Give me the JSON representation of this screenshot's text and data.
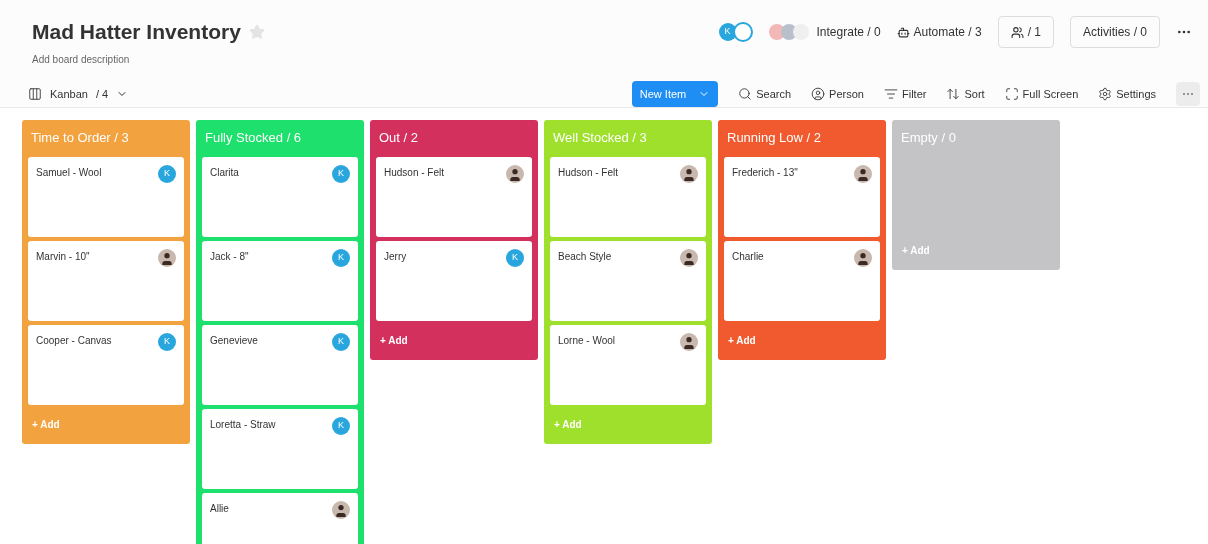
{
  "board": {
    "title": "Mad Hatter Inventory",
    "description": "Add board description",
    "view": {
      "label": "Kanban",
      "count": "/ 4"
    }
  },
  "top_bar": {
    "avatar_initial": "K",
    "integrate": "Integrate / 0",
    "automate": "Automate / 3",
    "members": "/ 1",
    "activities": "Activities / 0"
  },
  "toolbar": {
    "new_item": "New Item",
    "search": "Search",
    "person": "Person",
    "filter": "Filter",
    "sort": "Sort",
    "full_screen": "Full Screen",
    "settings": "Settings"
  },
  "columns": [
    {
      "title": "Time to Order / 3",
      "color": "#f2a23e",
      "add": "+ Add",
      "cards": [
        {
          "name": "Samuel - Wool",
          "assignee": {
            "kind": "initial",
            "text": "K"
          }
        },
        {
          "name": "Marvin - 10\"",
          "assignee": {
            "kind": "photo"
          }
        },
        {
          "name": "Cooper - Canvas",
          "assignee": {
            "kind": "initial",
            "text": "K"
          }
        }
      ]
    },
    {
      "title": "Fully Stocked / 6",
      "color": "#1ee06c",
      "cards": [
        {
          "name": "Clarita",
          "assignee": {
            "kind": "initial",
            "text": "K"
          }
        },
        {
          "name": "Jack - 8\"",
          "assignee": {
            "kind": "initial",
            "text": "K"
          }
        },
        {
          "name": "Genevieve",
          "assignee": {
            "kind": "initial",
            "text": "K"
          }
        },
        {
          "name": "Loretta - Straw",
          "assignee": {
            "kind": "initial",
            "text": "K"
          }
        },
        {
          "name": "Allie",
          "assignee": {
            "kind": "photo"
          }
        }
      ]
    },
    {
      "title": "Out / 2",
      "color": "#d3305e",
      "add": "+ Add",
      "cards": [
        {
          "name": "Hudson - Felt",
          "assignee": {
            "kind": "photo"
          }
        },
        {
          "name": "Jerry",
          "assignee": {
            "kind": "initial",
            "text": "K"
          }
        }
      ]
    },
    {
      "title": "Well Stocked / 3",
      "color": "#9ee02c",
      "add": "+ Add",
      "cards": [
        {
          "name": "Hudson - Felt",
          "assignee": {
            "kind": "photo"
          }
        },
        {
          "name": "Beach Style",
          "assignee": {
            "kind": "photo"
          }
        },
        {
          "name": "Lorne - Wool",
          "assignee": {
            "kind": "photo"
          }
        }
      ]
    },
    {
      "title": "Running Low / 2",
      "color": "#f05a2e",
      "add": "+ Add",
      "cards": [
        {
          "name": "Frederich - 13\"",
          "assignee": {
            "kind": "photo"
          }
        },
        {
          "name": "Charlie",
          "assignee": {
            "kind": "photo"
          }
        }
      ]
    },
    {
      "title": "Empty / 0",
      "color": "#c4c4c6",
      "add": "+ Add"
    }
  ]
}
